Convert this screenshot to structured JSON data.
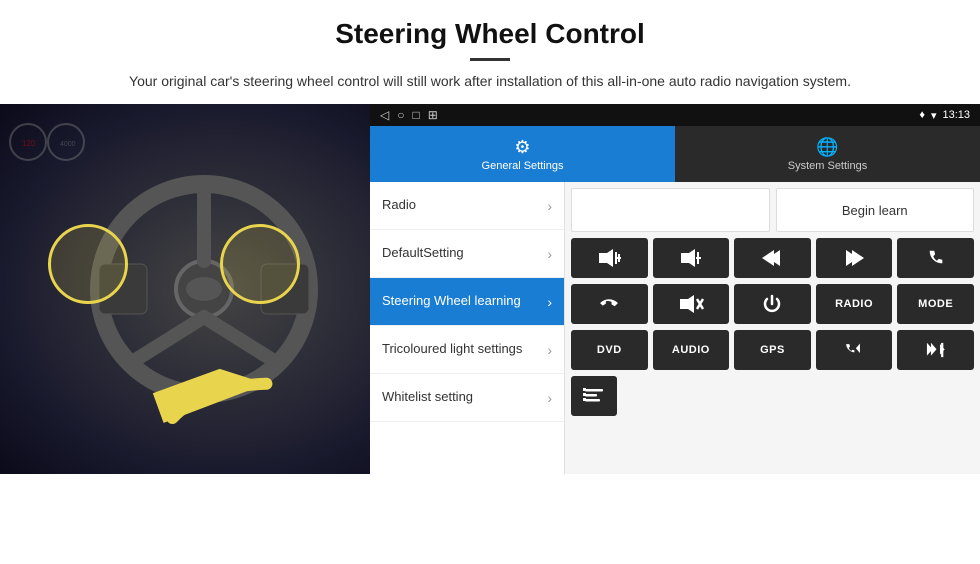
{
  "header": {
    "title": "Steering Wheel Control",
    "description": "Your original car's steering wheel control will still work after installation of this all-in-one auto radio navigation system."
  },
  "status_bar": {
    "nav_icons": [
      "◁",
      "○",
      "□",
      "⊞"
    ],
    "right_icons": "♦ ▾ 13:13"
  },
  "tabs": [
    {
      "id": "general",
      "label": "General Settings",
      "icon": "⚙",
      "active": true
    },
    {
      "id": "system",
      "label": "System Settings",
      "icon": "🌐",
      "active": false
    }
  ],
  "menu_items": [
    {
      "id": "radio",
      "label": "Radio",
      "active": false
    },
    {
      "id": "default",
      "label": "DefaultSetting",
      "active": false
    },
    {
      "id": "steering",
      "label": "Steering Wheel learning",
      "active": true
    },
    {
      "id": "tricoloured",
      "label": "Tricoloured light settings",
      "active": false
    },
    {
      "id": "whitelist",
      "label": "Whitelist setting",
      "active": false
    }
  ],
  "controls": {
    "begin_learn_label": "Begin learn",
    "row1": [
      {
        "icon": "🔊+",
        "type": "icon"
      },
      {
        "icon": "🔉-",
        "type": "icon"
      },
      {
        "icon": "⏮",
        "type": "icon"
      },
      {
        "icon": "⏭",
        "type": "icon"
      },
      {
        "icon": "📞",
        "type": "icon"
      }
    ],
    "row2": [
      {
        "icon": "📞↩",
        "type": "icon"
      },
      {
        "icon": "🔇",
        "type": "icon"
      },
      {
        "icon": "⏻",
        "type": "icon"
      },
      {
        "label": "RADIO",
        "type": "text"
      },
      {
        "label": "MODE",
        "type": "text"
      }
    ],
    "row3": [
      {
        "label": "DVD",
        "type": "text"
      },
      {
        "label": "AUDIO",
        "type": "text"
      },
      {
        "label": "GPS",
        "type": "text"
      },
      {
        "icon": "📞⏮",
        "type": "icon"
      },
      {
        "icon": "⏮⏭",
        "type": "icon"
      }
    ],
    "row4": [
      {
        "icon": "≡",
        "type": "icon"
      }
    ]
  }
}
